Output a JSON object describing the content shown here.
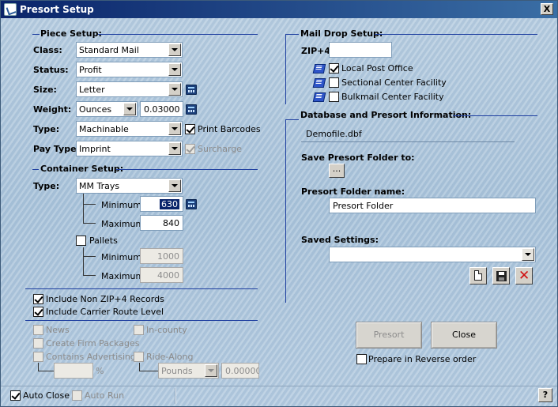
{
  "window": {
    "title": "Presort Setup",
    "close_glyph": "X"
  },
  "piece_setup": {
    "title": "Piece Setup:",
    "class_label": "Class:",
    "class_value": "Standard Mail",
    "status_label": "Status:",
    "status_value": "Profit",
    "size_label": "Size:",
    "size_value": "Letter",
    "weight_label": "Weight:",
    "weight_unit": "Ounces",
    "weight_value": "0.03000",
    "type_label": "Type:",
    "type_value": "Machinable",
    "print_barcodes_label": "Print Barcodes",
    "print_barcodes_checked": true,
    "pay_type_label": "Pay Type:",
    "pay_type_value": "Imprint",
    "surcharge_label": "Surcharge",
    "surcharge_checked": true
  },
  "container_setup": {
    "title": "Container Setup:",
    "type_label": "Type:",
    "type_value": "MM Trays",
    "minimum_label": "Minimum:",
    "minimum_value": "630",
    "maximum_label": "Maximum:",
    "maximum_value": "840",
    "pallets_label": "Pallets",
    "pallets_checked": false,
    "pallet_minimum_label": "Minimum:",
    "pallet_minimum_value": "1000",
    "pallet_maximum_label": "Maximum:",
    "pallet_maximum_value": "4000"
  },
  "options": {
    "include_non_zip4_label": "Include Non ZIP+4 Records",
    "include_non_zip4_checked": true,
    "include_carrier_route_label": "Include Carrier Route Level",
    "include_carrier_route_checked": true,
    "news_label": "News",
    "in_county_label": "In-county",
    "create_firm_label": "Create Firm Packages",
    "contains_advertising_label": "Contains Advertising",
    "ride_along_label": "Ride-Along",
    "percent_symbol": "%",
    "ride_along_unit": "Pounds",
    "ride_along_value": "0.00000"
  },
  "mail_drop": {
    "title": "Mail Drop Setup:",
    "zip_label": "ZIP+4:",
    "zip_value": "",
    "local_post_office_label": "Local Post Office",
    "local_post_office_checked": true,
    "sectional_center_label": "Sectional Center Facility",
    "sectional_center_checked": false,
    "bulkmail_center_label": "Bulkmail Center Facility",
    "bulkmail_center_checked": false
  },
  "database": {
    "title": "Database and Presort Information:",
    "file_name": "Demofile.dbf",
    "save_folder_label": "Save Presort Folder to:",
    "browse_label": "...",
    "folder_name_label": "Presort Folder name:",
    "folder_name_value": "Presort Folder",
    "saved_settings_label": "Saved Settings:",
    "saved_settings_value": ""
  },
  "actions": {
    "presort_label": "Presort",
    "close_label": "Close",
    "reverse_order_label": "Prepare in Reverse order",
    "reverse_order_checked": false
  },
  "statusbar": {
    "auto_close_label": "Auto Close",
    "auto_close_checked": true,
    "auto_run_label": "Auto Run",
    "auto_run_checked": false,
    "help_label": "?"
  }
}
